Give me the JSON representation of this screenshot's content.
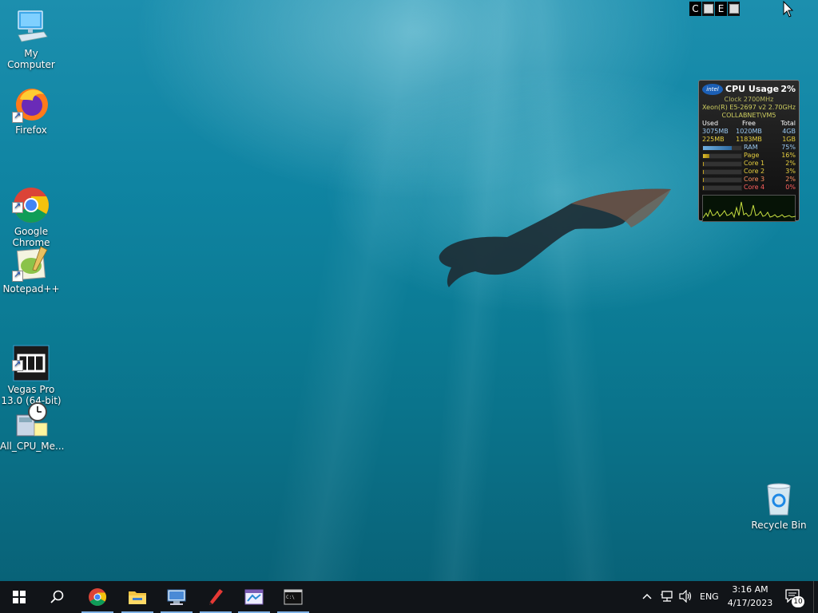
{
  "desktop": {
    "icons": [
      {
        "label": "My Computer"
      },
      {
        "label": "Firefox"
      },
      {
        "label": "Google\nChrome"
      },
      {
        "label": "Notepad++"
      },
      {
        "label": "Vegas Pro\n13.0 (64-bit)"
      },
      {
        "label": "All_CPU_Me..."
      }
    ],
    "recycle_bin": {
      "label": "Recycle Bin"
    }
  },
  "top_tray": {
    "c_label": "C",
    "e_label": "E"
  },
  "cpu_gadget": {
    "brand": "intel",
    "title": "CPU Usage",
    "usage": "2%",
    "clock": "Clock 2700MHz",
    "processor": "Xeon(R) E5-2697 v2 2.70GHz",
    "host": "COLLABNET\\VM5",
    "headers": [
      "Used",
      "Free",
      "Total"
    ],
    "ram_row": [
      "3075MB",
      "1020MB",
      "4GB"
    ],
    "page_row": [
      "225MB",
      "1183MB",
      "1GB"
    ],
    "meters": [
      {
        "label": "RAM",
        "value": "75%",
        "fill": 0.75
      },
      {
        "label": "Page",
        "value": "16%",
        "fill": 0.16
      },
      {
        "label": "Core 1",
        "value": "2%",
        "fill": 0.02
      },
      {
        "label": "Core 2",
        "value": "3%",
        "fill": 0.03
      },
      {
        "label": "Core 3",
        "value": "2%",
        "fill": 0.02
      },
      {
        "label": "Core 4",
        "value": "0%",
        "fill": 0.0
      }
    ],
    "colors": {
      "label": "#c8c85a",
      "value": "#9ac8f0",
      "core_label": "#e8d040",
      "core4": "#ff6060"
    }
  },
  "taskbar": {
    "language": "ENG",
    "time": "3:16 AM",
    "date": "4/17/2023",
    "notification_count": "10"
  }
}
